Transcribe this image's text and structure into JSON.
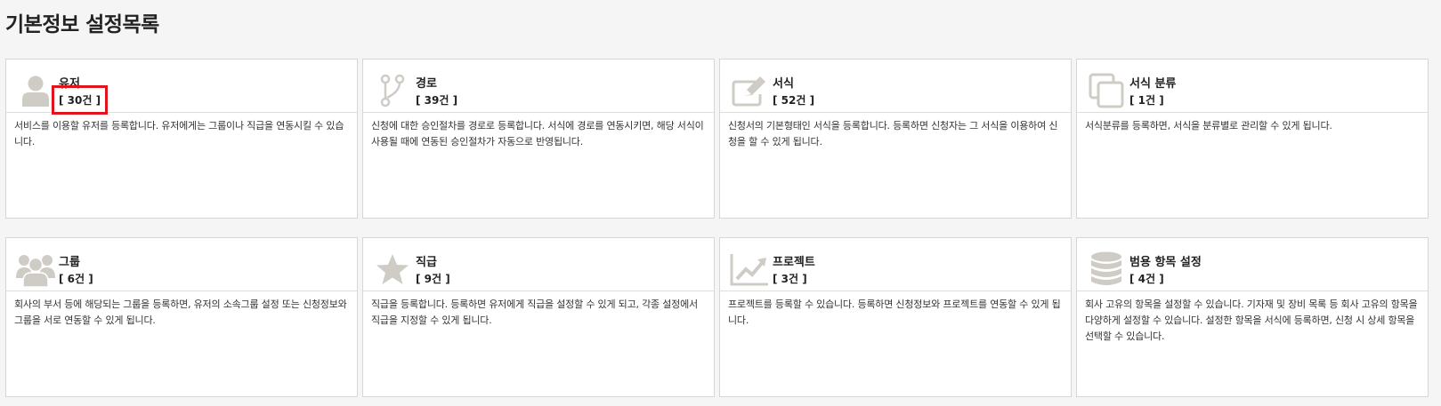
{
  "page": {
    "title": "기본정보 설정목록"
  },
  "colors": {
    "icon": "#cfccc6",
    "highlight": "#e0141c"
  },
  "cards": [
    {
      "title": "유저",
      "count": "[ 30건 ]",
      "icon": "user-icon",
      "description": "서비스를 이용할 유저를 등록합니다. 유저에게는 그룹이나 직급을 연동시킬 수 있습니다."
    },
    {
      "title": "경로",
      "count": "[ 39건 ]",
      "icon": "branch-icon",
      "description": "신청에 대한 승인절차를 경로로 등록합니다. 서식에 경로를 연동시키면, 해당 서식이 사용될 때에 연동된 승인절차가 자동으로 반영됩니다."
    },
    {
      "title": "서식",
      "count": "[ 52건 ]",
      "icon": "edit-icon",
      "description": "신청서의 기본형태인 서식을 등록합니다. 등록하면 신청자는 그 서식을 이용하여 신청을 할 수 있게 됩니다."
    },
    {
      "title": "서식 분류",
      "count": "[ 1건 ]",
      "icon": "copy-icon",
      "description": "서식분류를 등록하면, 서식을 분류별로 관리할 수 있게 됩니다."
    },
    {
      "title": "그룹",
      "count": "[ 6건 ]",
      "icon": "group-icon",
      "description": "회사의 부서 등에 해당되는 그룹을 등록하면, 유저의 소속그룹 설정 또는 신청정보와 그룹을 서로 연동할 수 있게 됩니다."
    },
    {
      "title": "직급",
      "count": "[ 9건 ]",
      "icon": "star-icon",
      "description": "직급을 등록합니다. 등록하면 유저에게 직급을 설정할 수 있게 되고, 각종 설정에서 직급을 지정할 수 있게 됩니다."
    },
    {
      "title": "프로젝트",
      "count": "[ 3건 ]",
      "icon": "chart-icon",
      "description": "프로젝트를 등록할 수 있습니다. 등록하면 신청정보와 프로젝트를 연동할 수 있게 됩니다."
    },
    {
      "title": "범용 항목 설정",
      "count": "[ 4건 ]",
      "icon": "database-icon",
      "description": "회사 고유의 항목을 설정할 수 있습니다. 기자재 및 장비 목록 등 회사 고유의 항목을 다양하게 설정할 수 있습니다. 설정한 항목을 서식에 등록하면, 신청 시 상세 항목을 선택할 수 있습니다."
    }
  ]
}
